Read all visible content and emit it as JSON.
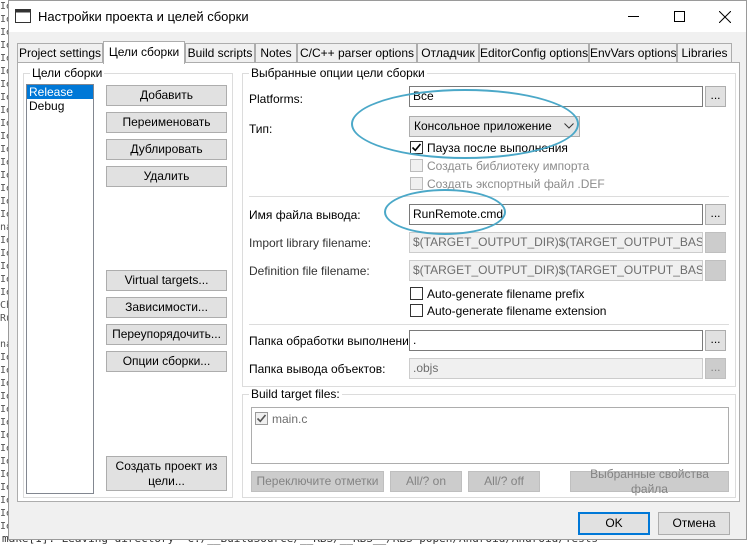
{
  "background": {
    "gutter_lines": [
      "Ie",
      "Ie",
      "Ie",
      "Ie",
      "Ie",
      "Ie",
      "Ie",
      "Ie",
      "Ie",
      "Ie",
      "Ie",
      "Ie",
      "Ie",
      "Ie",
      "Ie",
      "Ie",
      "Ie",
      "na",
      "Ie",
      "Ie",
      "Ie",
      "Ie",
      "Ie",
      "Ch",
      "Ru",
      "",
      "na",
      "Ie",
      "Ie",
      "Ie",
      "Ie",
      "Ie",
      "Ie",
      "Ie",
      "Ie",
      "Ie",
      "Ie",
      "Ie",
      "Ie",
      "Ie",
      "Ie"
    ],
    "bottom_line": "make[1]: Leaving directory 'C:/__BuildSource/__RBS/__RBS__/RBS-popen/Android/Android/Tests'"
  },
  "window": {
    "title": "Настройки проекта и целей сборки",
    "minimize_icon": "minimize-icon",
    "maximize_icon": "maximize-icon",
    "close_icon": "close-icon"
  },
  "tabs": [
    {
      "label": "Project settings",
      "active": false
    },
    {
      "label": "Цели сборки",
      "active": true
    },
    {
      "label": "Build scripts",
      "active": false
    },
    {
      "label": "Notes",
      "active": false
    },
    {
      "label": "C/C++ parser options",
      "active": false
    },
    {
      "label": "Отладчик",
      "active": false
    },
    {
      "label": "EditorConfig options",
      "active": false
    },
    {
      "label": "EnvVars options",
      "active": false
    },
    {
      "label": "Libraries",
      "active": false
    }
  ],
  "targets_group": {
    "title": "Цели сборки",
    "items": [
      {
        "label": "Release",
        "selected": true
      },
      {
        "label": "Debug",
        "selected": false
      }
    ],
    "buttons": {
      "add": "Добавить",
      "rename": "Переименовать",
      "duplicate": "Дублировать",
      "delete": "Удалить",
      "virtual": "Virtual targets...",
      "deps": "Зависимости...",
      "reorder": "Переупорядочить...",
      "options": "Опции сборки...",
      "create_project": "Создать проект из цели..."
    }
  },
  "options_group": {
    "title": "Выбранные опции цели сборки",
    "platforms_label": "Platforms:",
    "platforms_value": "Все",
    "type_label": "Тип:",
    "type_value": "Консольное приложение",
    "pause_checkbox": {
      "label": "Пауза после выполнения",
      "checked": true
    },
    "import_lib_checkbox": {
      "label": "Создать библиотеку импорта",
      "checked": false
    },
    "def_file_checkbox": {
      "label": "Создать экспортный файл .DEF",
      "checked": false
    },
    "output_label": "Имя файла вывода:",
    "output_value": "RunRemote.cmd",
    "import_filename_label": "Import library filename:",
    "import_filename_value": "$(TARGET_OUTPUT_DIR)$(TARGET_OUTPUT_BASENAME)",
    "def_filename_label": "Definition file filename:",
    "def_filename_value": "$(TARGET_OUTPUT_DIR)$(TARGET_OUTPUT_BASENAME)",
    "auto_prefix": {
      "label": "Auto-generate filename prefix",
      "checked": false
    },
    "auto_extension": {
      "label": "Auto-generate filename extension",
      "checked": false
    },
    "workdir_label": "Папка обработки выполнения:",
    "workdir_value": ".",
    "objdir_label": "Папка вывода объектов:",
    "objdir_value": ".objs",
    "ellipsis": "..."
  },
  "files_group": {
    "title": "Build target files:",
    "files": [
      {
        "label": "main.c",
        "checked": true
      }
    ],
    "buttons": {
      "toggle": "Переключите отметки",
      "all_on": "All/? on",
      "all_off": "All/? off",
      "properties": "Выбранные свойства файла"
    }
  },
  "footer": {
    "ok": "OK",
    "cancel": "Отмена"
  },
  "colors": {
    "selection": "#0078d7",
    "annotation": "#4ba8c8"
  }
}
